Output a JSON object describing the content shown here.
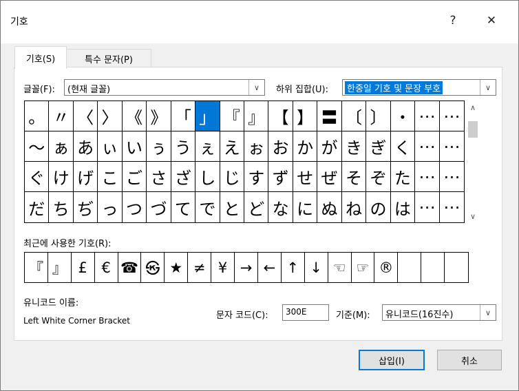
{
  "window": {
    "title": "기호",
    "help_label": "?",
    "close_label": "✕"
  },
  "tabs": [
    {
      "label": "기호(S)",
      "active": true
    },
    {
      "label": "특수 문자(P)",
      "active": false
    }
  ],
  "font": {
    "label": "글꼴(F):",
    "value": "(현재 글꼴)"
  },
  "subset": {
    "label": "하위 집합(U):",
    "value": "한중일 기호 및 문장 부호"
  },
  "symbol_grid": {
    "selected_index": 7,
    "rows": [
      [
        "。",
        "〃",
        "〈",
        "〉",
        "《",
        "》",
        "「",
        "」",
        "『",
        "』",
        "【",
        "】",
        "〓",
        "〔",
        "〕",
        "・",
        "⋯",
        "⋯"
      ],
      [
        "〜",
        "ぁ",
        "あ",
        "ぃ",
        "い",
        "ぅ",
        "う",
        "ぇ",
        "え",
        "ぉ",
        "お",
        "か",
        "が",
        "き",
        "ぎ",
        "く",
        "⋯",
        "⋯"
      ],
      [
        "ぐ",
        "け",
        "げ",
        "こ",
        "ご",
        "さ",
        "ざ",
        "し",
        "じ",
        "す",
        "ず",
        "せ",
        "ぜ",
        "そ",
        "ぞ",
        "た",
        "⋯",
        "⋯"
      ],
      [
        "だ",
        "ち",
        "ぢ",
        "っ",
        "つ",
        "づ",
        "て",
        "で",
        "と",
        "ど",
        "な",
        "に",
        "ぬ",
        "ね",
        "の",
        "は",
        "⋯",
        "⋯"
      ]
    ]
  },
  "recent": {
    "label": "최근에 사용한 기호(R):",
    "symbols": [
      "『",
      "』",
      "£",
      "€",
      "☎",
      "㉿",
      "★",
      "≠",
      "¥",
      "→",
      "←",
      "↑",
      "↓",
      "☜",
      "☞",
      "®",
      "",
      "",
      ""
    ]
  },
  "unicode_name": {
    "label": "유니코드 이름:",
    "value": "Left White Corner Bracket"
  },
  "char_code": {
    "label": "문자 코드(C):",
    "value": "300E"
  },
  "base": {
    "label": "기준(M):",
    "value": "유니코드(16진수)"
  },
  "buttons": {
    "insert": "삽입(I)",
    "cancel": "취소"
  }
}
